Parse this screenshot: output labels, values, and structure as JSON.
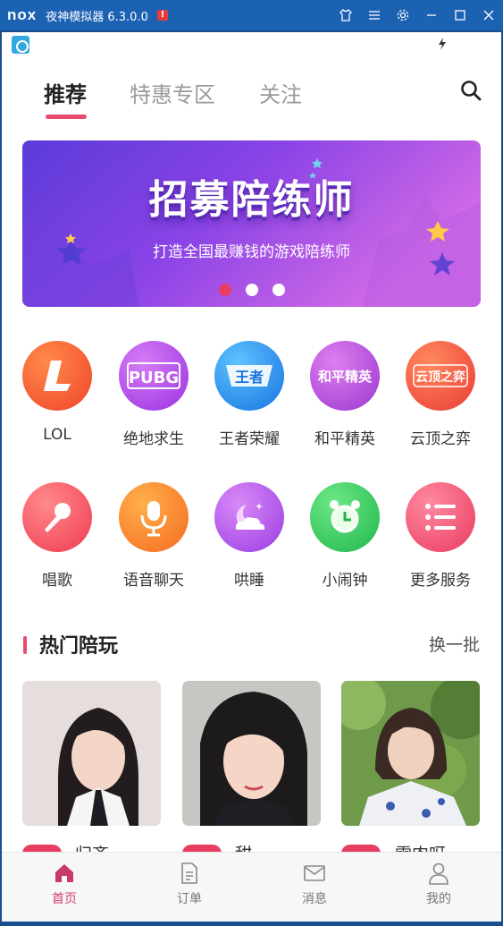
{
  "emulator": {
    "logo": "nox",
    "title": "夜神模拟器 6.3.0.0",
    "badge": "!"
  },
  "tabs": [
    {
      "label": "推荐",
      "active": true
    },
    {
      "label": "特惠专区",
      "active": false
    },
    {
      "label": "关注",
      "active": false
    }
  ],
  "banner": {
    "title": "招募陪练师",
    "subtitle": "打造全国最赚钱的游戏陪练师",
    "slide_count": 3,
    "active_slide": 1
  },
  "categories_row1": [
    {
      "label": "LOL",
      "icon": "lol-logo",
      "icon_text": "L",
      "color": "#f25a2e"
    },
    {
      "label": "绝地求生",
      "icon": "pubg-logo",
      "icon_text": "PUBG",
      "color": "#b548e8"
    },
    {
      "label": "王者荣耀",
      "icon": "wangzhe-logo",
      "icon_text": "王者",
      "color": "#1f8ce8"
    },
    {
      "label": "和平精英",
      "icon": "heping-logo",
      "icon_text": "和平精英",
      "color": "#b64ad8"
    },
    {
      "label": "云顶之弈",
      "icon": "yunding-logo",
      "icon_text": "云顶之弈",
      "color": "#f0553c"
    }
  ],
  "categories_row2": [
    {
      "label": "唱歌",
      "icon": "microphone-icon",
      "color": "#f2475c"
    },
    {
      "label": "语音聊天",
      "icon": "voice-mic-icon",
      "color": "#f7822b"
    },
    {
      "label": "哄睡",
      "icon": "moon-cloud-icon",
      "color": "#b150ea"
    },
    {
      "label": "小闹钟",
      "icon": "alarm-clock-icon",
      "color": "#2fc95c"
    },
    {
      "label": "更多服务",
      "icon": "list-icon",
      "color": "#ec4668"
    }
  ],
  "hot": {
    "title": "热门陪玩",
    "refresh_label": "换一批",
    "cards": [
      {
        "name": "归齐"
      },
      {
        "name": "甜"
      },
      {
        "name": "雷肉呀"
      }
    ]
  },
  "bottom_nav": [
    {
      "label": "首页",
      "icon": "home-icon",
      "active": true
    },
    {
      "label": "订单",
      "icon": "order-document-icon",
      "active": false
    },
    {
      "label": "消息",
      "icon": "message-envelope-icon",
      "active": false
    },
    {
      "label": "我的",
      "icon": "profile-person-icon",
      "active": false
    }
  ],
  "colors": {
    "accent": "#e94a6e",
    "emulator_bar": "#1b62b3",
    "banner_start": "#7b3df0",
    "banner_end": "#d266e8"
  }
}
